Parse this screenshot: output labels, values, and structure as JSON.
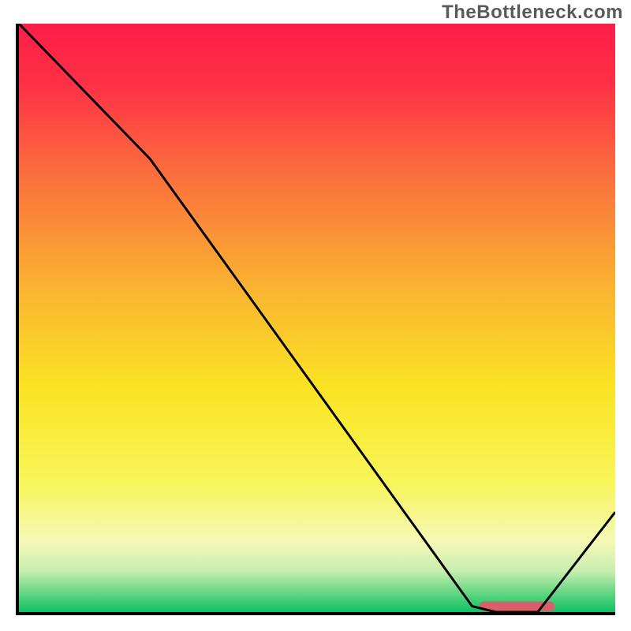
{
  "watermark": "TheBottleneck.com",
  "chart_data": {
    "type": "line",
    "title": "",
    "xlabel": "",
    "ylabel": "",
    "xlim": [
      0,
      100
    ],
    "ylim": [
      0,
      100
    ],
    "grid": false,
    "legend": false,
    "series": [
      {
        "name": "bottleneck-curve",
        "color": "#000000",
        "x": [
          0,
          22,
          76,
          80,
          87,
          100
        ],
        "y": [
          100,
          77,
          1,
          0,
          0,
          17
        ]
      }
    ],
    "marker": {
      "name": "optimal-range",
      "color": "#d9606b",
      "x_start": 78,
      "x_end": 89,
      "y": 1.0,
      "thickness": 12
    },
    "background_gradient": {
      "stops": [
        {
          "offset": 0.0,
          "color": "#fd1e47"
        },
        {
          "offset": 0.1,
          "color": "#fd3046"
        },
        {
          "offset": 0.25,
          "color": "#fb6c3d"
        },
        {
          "offset": 0.45,
          "color": "#fab431"
        },
        {
          "offset": 0.62,
          "color": "#fbe324"
        },
        {
          "offset": 0.78,
          "color": "#f8f65a"
        },
        {
          "offset": 0.88,
          "color": "#f6f8b8"
        },
        {
          "offset": 0.93,
          "color": "#c7efaf"
        },
        {
          "offset": 0.965,
          "color": "#69d886"
        },
        {
          "offset": 1.0,
          "color": "#0ec163"
        }
      ]
    }
  }
}
